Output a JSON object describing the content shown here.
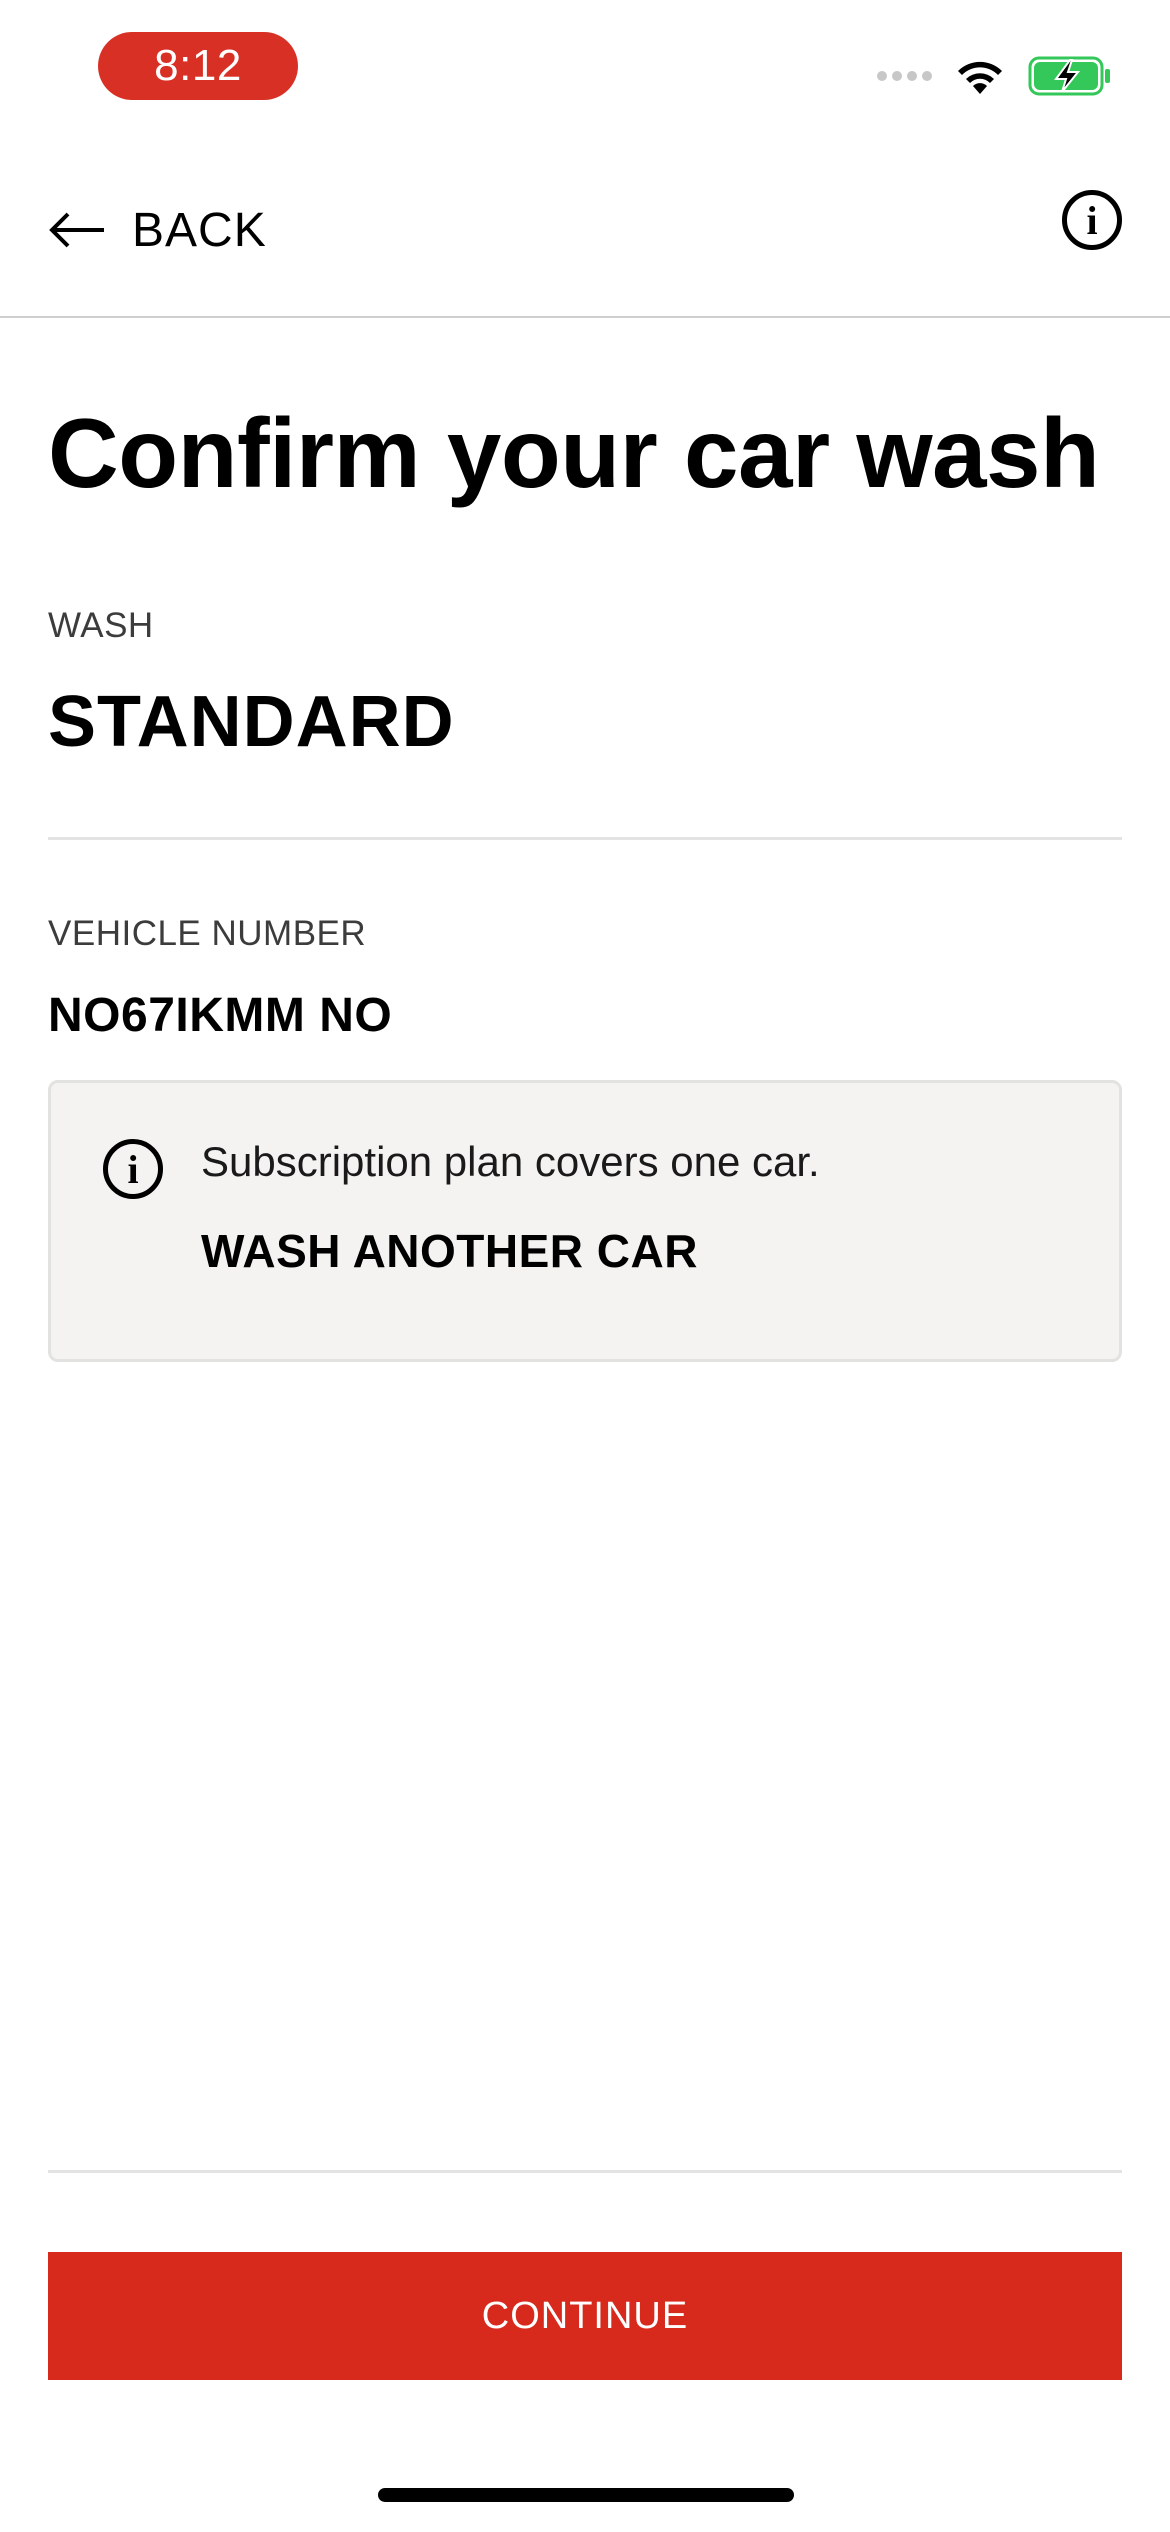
{
  "status_bar": {
    "time": "8:12",
    "time_pill_color": "#d93025",
    "icons": [
      "signal-dots-icon",
      "wifi-icon",
      "battery-charging-icon"
    ],
    "battery_color": "#34c759"
  },
  "header": {
    "back_label": "BACK",
    "back_icon": "arrow-left-icon",
    "info_icon": "info-icon",
    "info_glyph": "i"
  },
  "main": {
    "title": "Confirm your car wash",
    "wash": {
      "label": "WASH",
      "value": "STANDARD"
    },
    "vehicle": {
      "label": "VEHICLE NUMBER",
      "value": "NO67IKMM NO"
    },
    "notice": {
      "icon": "info-icon",
      "icon_glyph": "i",
      "text": "Subscription plan covers one car.",
      "link_label": "WASH ANOTHER CAR"
    }
  },
  "footer": {
    "continue_label": "CONTINUE",
    "accent_color": "#d8291d"
  }
}
